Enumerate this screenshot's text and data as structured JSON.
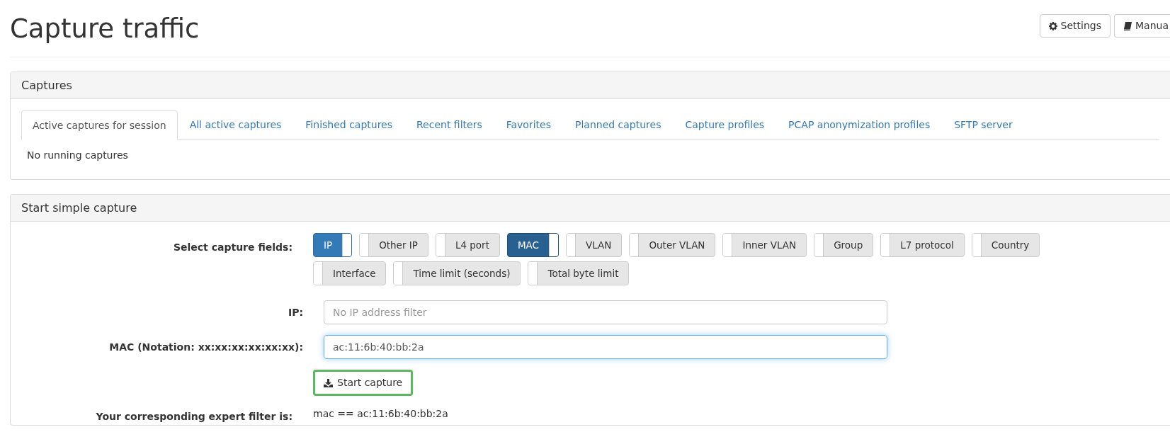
{
  "page_title": "Capture traffic",
  "header_buttons": [
    {
      "kind": "settings",
      "label": "Settings"
    },
    {
      "kind": "manual",
      "label": "Manua"
    }
  ],
  "captures_panel": {
    "title": "Captures",
    "tabs": [
      {
        "label": "Active captures for session",
        "selected": true
      },
      {
        "label": "All active captures",
        "selected": false
      },
      {
        "label": "Finished captures",
        "selected": false
      },
      {
        "label": "Recent filters",
        "selected": false
      },
      {
        "label": "Favorites",
        "selected": false
      },
      {
        "label": "Planned captures",
        "selected": false
      },
      {
        "label": "Capture profiles",
        "selected": false
      },
      {
        "label": "PCAP anonymization profiles",
        "selected": false
      },
      {
        "label": "SFTP server",
        "selected": false
      }
    ],
    "empty_message": "No running captures"
  },
  "simple_capture_panel": {
    "title": "Start simple capture",
    "fields_label": "Select capture fields:",
    "toggles": [
      {
        "label": "IP",
        "on": true,
        "focused": false
      },
      {
        "label": "Other IP",
        "on": false,
        "focused": false
      },
      {
        "label": "L4 port",
        "on": false,
        "focused": false
      },
      {
        "label": "MAC",
        "on": true,
        "focused": true
      },
      {
        "label": "VLAN",
        "on": false,
        "focused": false
      },
      {
        "label": "Outer VLAN",
        "on": false,
        "focused": false
      },
      {
        "label": "Inner VLAN",
        "on": false,
        "focused": false
      },
      {
        "label": "Group",
        "on": false,
        "focused": false
      },
      {
        "label": "L7 protocol",
        "on": false,
        "focused": false
      },
      {
        "label": "Country",
        "on": false,
        "focused": false
      },
      {
        "label": "Interface",
        "on": false,
        "focused": false
      },
      {
        "label": "Time limit (seconds)",
        "on": false,
        "focused": false
      },
      {
        "label": "Total byte limit",
        "on": false,
        "focused": false
      }
    ],
    "inputs": [
      {
        "label": "IP:",
        "placeholder": "No IP address filter",
        "focused": false
      },
      {
        "label": "MAC (Notation: xx:xx:xx:xx:xx:xx):",
        "value": "ac:11:6b:40:bb:2a",
        "focused": true
      }
    ],
    "start_button": "Start capture",
    "expert_filter_label": "Your corresponding expert filter is:",
    "expert_filter": "mac == ac:11:6b:40:bb:2a"
  }
}
